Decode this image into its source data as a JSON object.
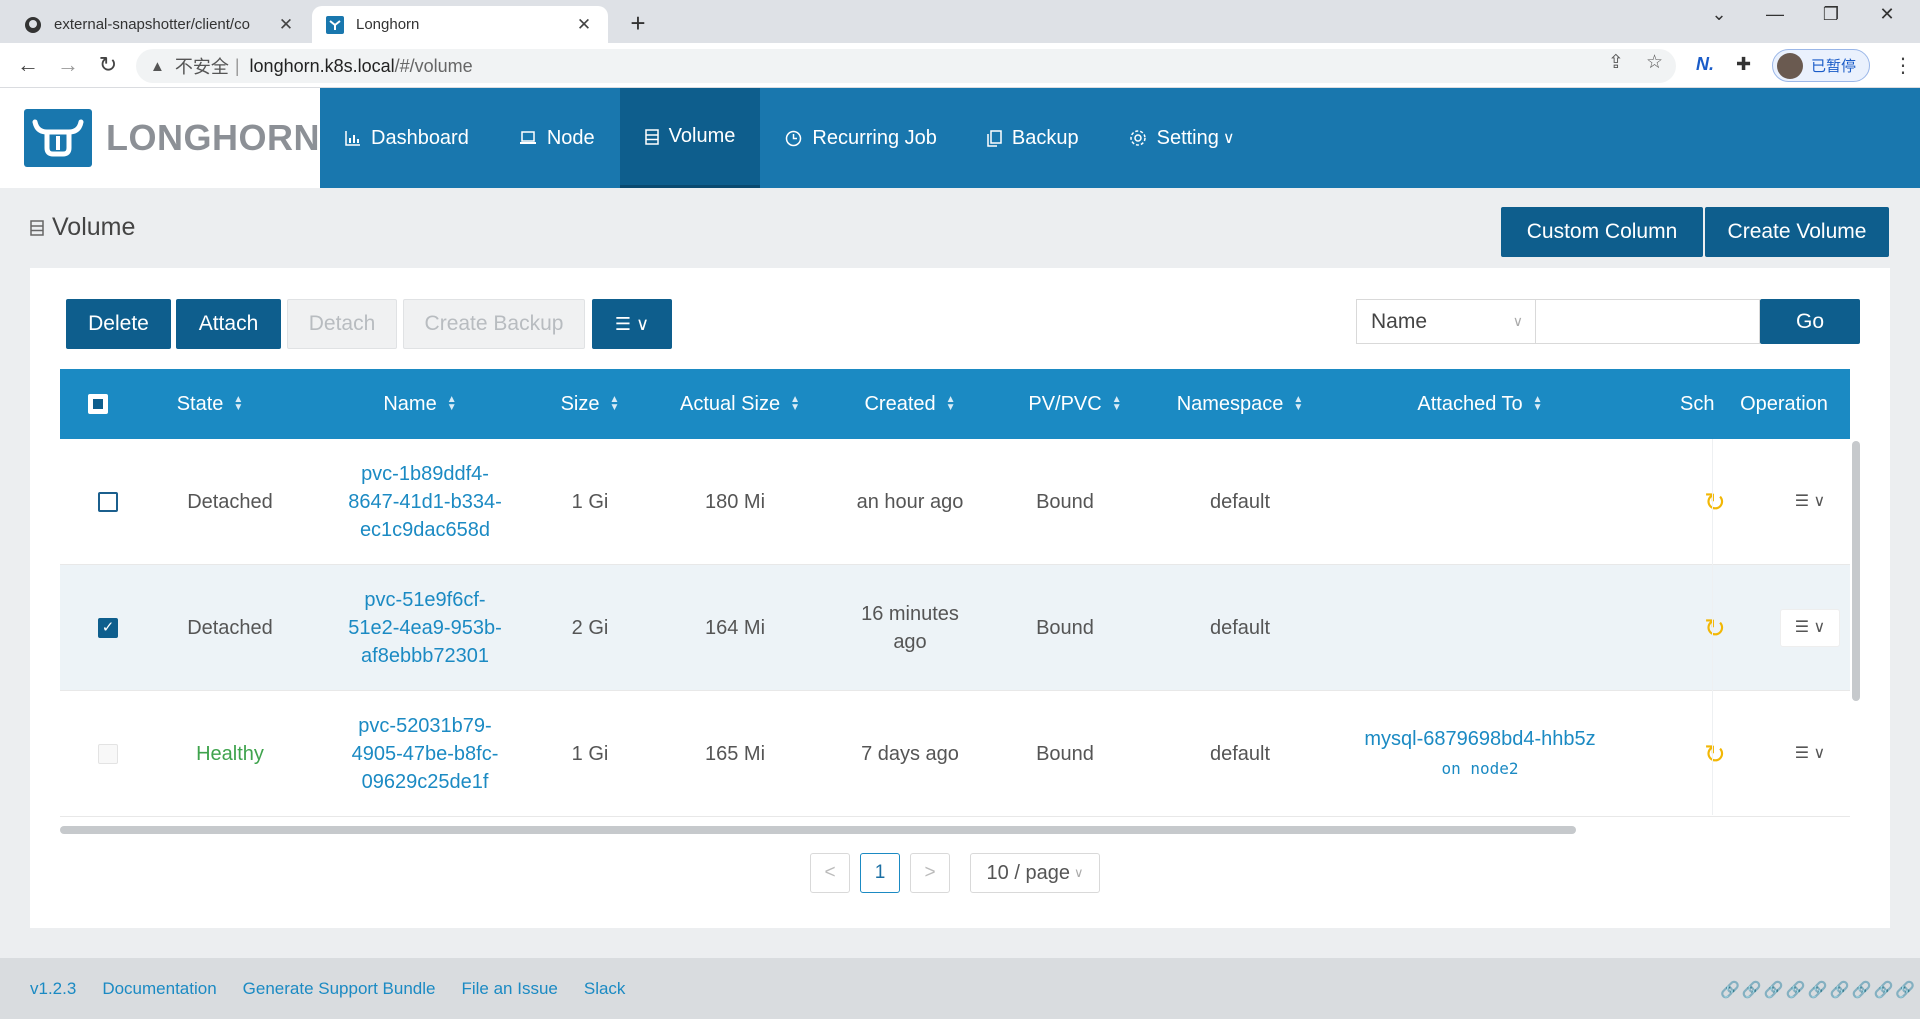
{
  "browser": {
    "tabs": [
      {
        "title": "external-snapshotter/client/co",
        "favicon": "github-icon",
        "active": false
      },
      {
        "title": "Longhorn",
        "favicon": "longhorn-icon",
        "active": true
      }
    ],
    "url": {
      "insecure_label": "不安全",
      "separator": "|",
      "host": "longhorn.k8s.local",
      "path": "/#/volume"
    },
    "profile_label": "已暂停"
  },
  "app": {
    "logo_text": "LONGHORN",
    "menu": [
      {
        "label": "Dashboard",
        "icon": "bar-chart-icon"
      },
      {
        "label": "Node",
        "icon": "laptop-icon"
      },
      {
        "label": "Volume",
        "icon": "database-icon",
        "active": true
      },
      {
        "label": "Recurring Job",
        "icon": "clock-icon"
      },
      {
        "label": "Backup",
        "icon": "copy-icon"
      },
      {
        "label": "Setting",
        "icon": "gear-icon",
        "has_dropdown": true
      }
    ]
  },
  "page": {
    "title": "Volume",
    "actions": {
      "custom_column": "Custom Column",
      "create_volume": "Create Volume"
    },
    "toolbar": {
      "delete": "Delete",
      "attach": "Attach",
      "detach": "Detach",
      "create_backup": "Create Backup"
    },
    "search": {
      "field": "Name",
      "value": "",
      "go": "Go"
    }
  },
  "table": {
    "columns": [
      "State",
      "Name",
      "Size",
      "Actual Size",
      "Created",
      "PV/PVC",
      "Namespace",
      "Attached To",
      "Sch",
      "Operation"
    ],
    "rows": [
      {
        "checked": false,
        "disabled": false,
        "state": "Detached",
        "name_l1": "pvc-1b89ddf4-",
        "name_l2": "8647-41d1-b334-",
        "name_l3": "ec1c9dac658d",
        "size": "1 Gi",
        "actual_size": "180 Mi",
        "created_l1": "an hour ago",
        "created_l2": "",
        "pvpvc": "Bound",
        "namespace": "default",
        "attached_to": "",
        "attached_node": ""
      },
      {
        "checked": true,
        "disabled": false,
        "state": "Detached",
        "name_l1": "pvc-51e9f6cf-",
        "name_l2": "51e2-4ea9-953b-",
        "name_l3": "af8ebbb72301",
        "size": "2 Gi",
        "actual_size": "164 Mi",
        "created_l1": "16 minutes",
        "created_l2": "ago",
        "pvpvc": "Bound",
        "namespace": "default",
        "attached_to": "",
        "attached_node": ""
      },
      {
        "checked": false,
        "disabled": true,
        "state": "Healthy",
        "name_l1": "pvc-52031b79-",
        "name_l2": "4905-47be-b8fc-",
        "name_l3": "09629c25de1f",
        "size": "1 Gi",
        "actual_size": "165 Mi",
        "created_l1": "7 days ago",
        "created_l2": "",
        "pvpvc": "Bound",
        "namespace": "default",
        "attached_to": "mysql-6879698bd4-hhb5z",
        "attached_node": "on node2"
      }
    ]
  },
  "pagination": {
    "prev": "<",
    "current": "1",
    "next": ">",
    "page_size": "10 / page"
  },
  "footer": {
    "version": "v1.2.3",
    "links": [
      "Documentation",
      "Generate Support Bundle",
      "File an Issue",
      "Slack"
    ]
  },
  "colors": {
    "header_blue": "#1977ae",
    "active_menu": "#0e5e8d",
    "table_header": "#1b8ac3",
    "healthy": "#3fa34d",
    "link": "#1b8ac3"
  }
}
